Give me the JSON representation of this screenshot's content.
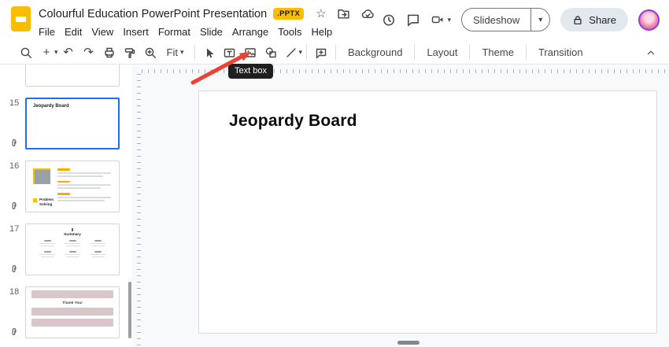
{
  "header": {
    "doc_title": "Colourful Education PowerPoint Presentation",
    "file_badge": ".PPTX",
    "menus": [
      "File",
      "Edit",
      "View",
      "Insert",
      "Format",
      "Slide",
      "Arrange",
      "Tools",
      "Help"
    ],
    "slideshow_label": "Slideshow",
    "share_label": "Share"
  },
  "toolbar": {
    "zoom_select": "Fit",
    "background_label": "Background",
    "layout_label": "Layout",
    "theme_label": "Theme",
    "transition_label": "Transition",
    "tooltip": "Text box"
  },
  "icons": {
    "star": "☆",
    "plus": "+",
    "undo": "↶",
    "redo": "↷",
    "chevron_down": "▾"
  },
  "filmstrip": {
    "slides": [
      {
        "number": "15",
        "title": "Jeopardy Board",
        "selected": true
      },
      {
        "number": "16",
        "title": "Problem Solving",
        "selected": false
      },
      {
        "number": "17",
        "title": "Summary",
        "selected": false
      },
      {
        "number": "18",
        "title": "Thank You!",
        "selected": false
      }
    ]
  },
  "canvas": {
    "slide_title": "Jeopardy Board"
  },
  "colors": {
    "brand_yellow": "#fbbc04",
    "selection_blue": "#1a73e8",
    "arrow_red": "#ea4335",
    "tooltip_bg": "#1f1f1f"
  }
}
